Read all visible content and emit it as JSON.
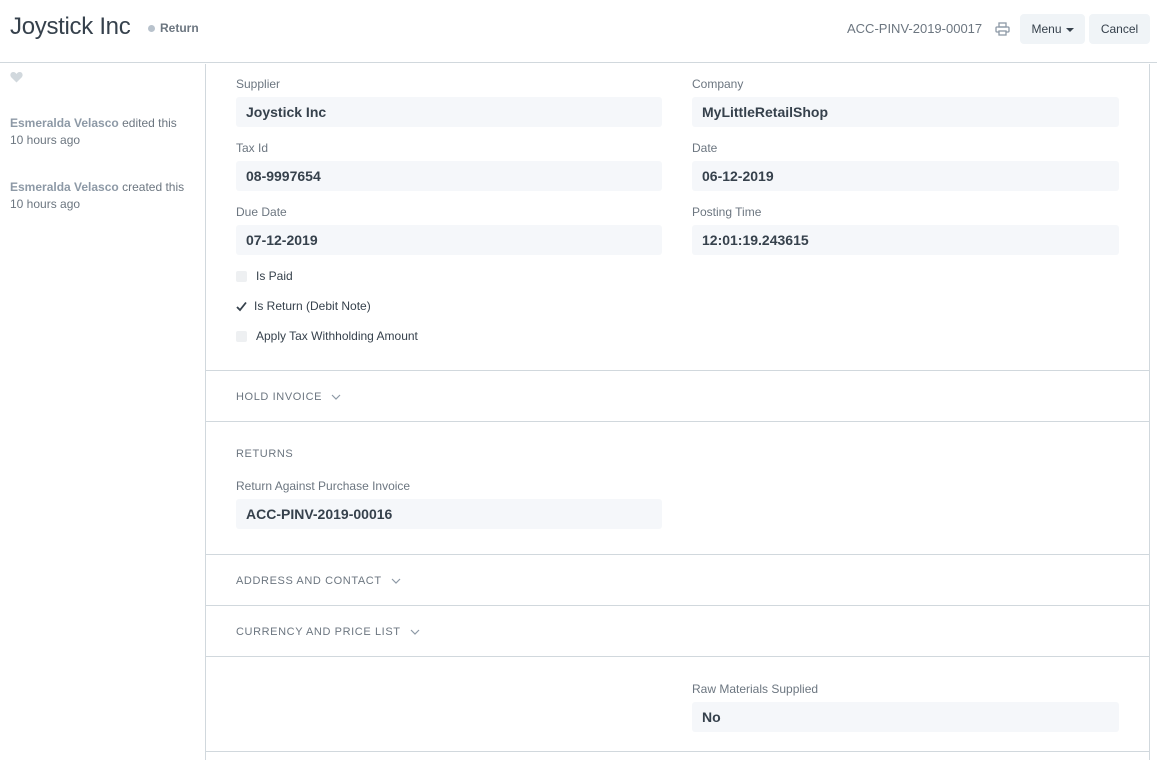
{
  "header": {
    "title": "Joystick Inc",
    "status": "Return",
    "doc_name": "ACC-PINV-2019-00017",
    "menu_label": "Menu",
    "cancel_label": "Cancel"
  },
  "sidebar": {
    "activities": [
      {
        "user": "Esmeralda Velasco",
        "action": "edited this",
        "time": "10 hours ago"
      },
      {
        "user": "Esmeralda Velasco",
        "action": "created this",
        "time": "10 hours ago"
      }
    ]
  },
  "form": {
    "supplier": {
      "label": "Supplier",
      "value": "Joystick Inc"
    },
    "company": {
      "label": "Company",
      "value": "MyLittleRetailShop"
    },
    "tax_id": {
      "label": "Tax Id",
      "value": "08-9997654"
    },
    "date": {
      "label": "Date",
      "value": "06-12-2019"
    },
    "due_date": {
      "label": "Due Date",
      "value": "07-12-2019"
    },
    "posting_time": {
      "label": "Posting Time",
      "value": "12:01:19.243615"
    },
    "is_paid": {
      "label": "Is Paid",
      "checked": false
    },
    "is_return": {
      "label": "Is Return (Debit Note)",
      "checked": true
    },
    "apply_tds": {
      "label": "Apply Tax Withholding Amount",
      "checked": false
    }
  },
  "sections": {
    "hold_invoice": "HOLD INVOICE",
    "returns": "RETURNS",
    "address_contact": "ADDRESS AND CONTACT",
    "currency_price": "CURRENCY AND PRICE LIST"
  },
  "returns": {
    "return_against": {
      "label": "Return Against Purchase Invoice",
      "value": "ACC-PINV-2019-00016"
    }
  },
  "raw_materials": {
    "label": "Raw Materials Supplied",
    "value": "No"
  },
  "colors": {
    "border": "#d1d8dd",
    "text": "#36414c",
    "muted": "#6c7680",
    "control_bg": "#f5f7fa",
    "button_bg": "#f0f4f7"
  }
}
